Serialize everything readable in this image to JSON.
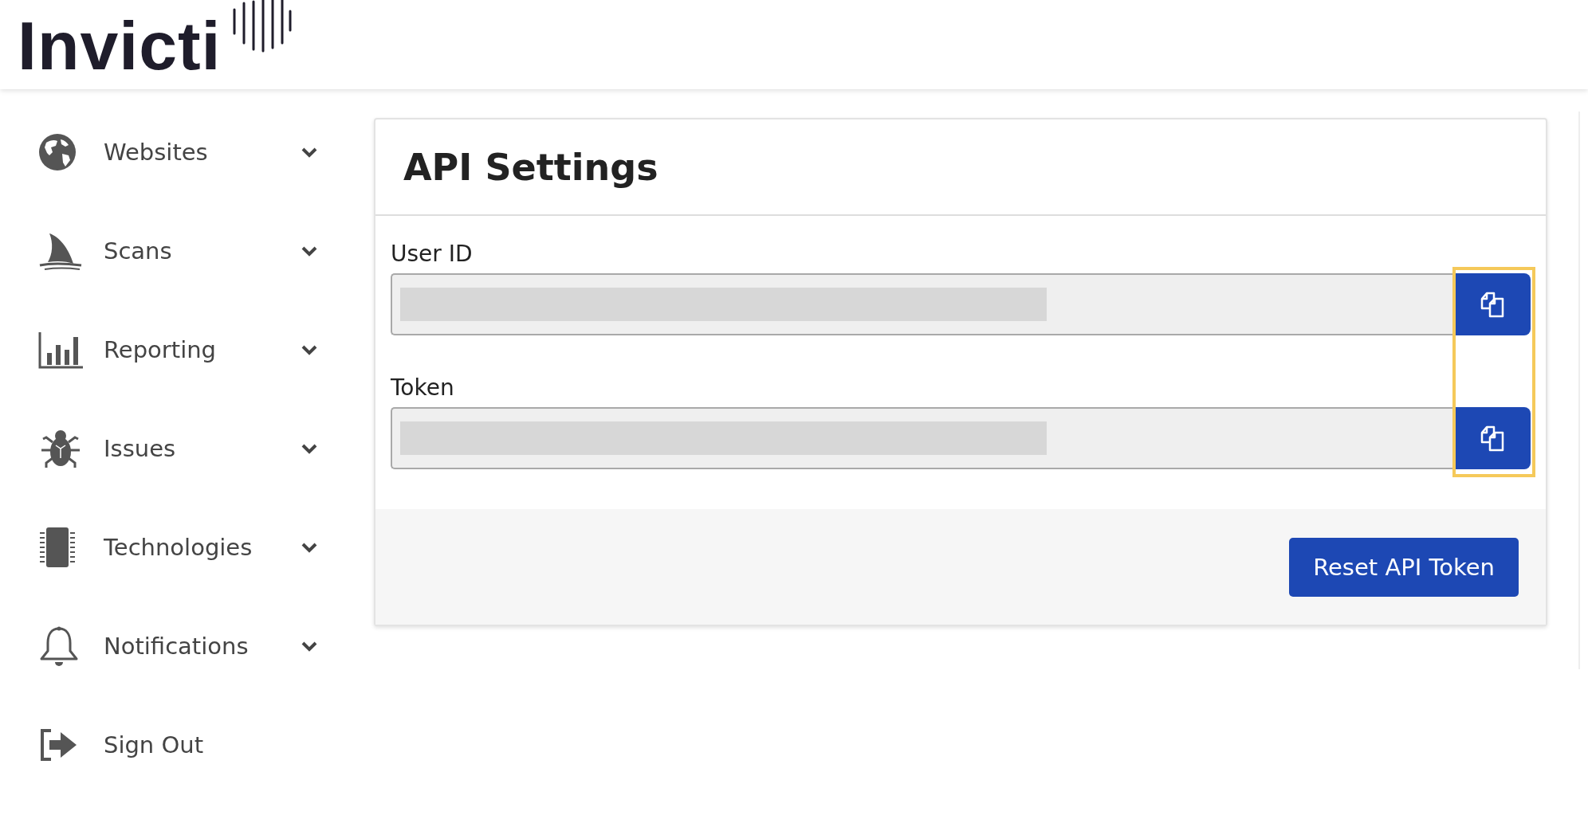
{
  "logo": {
    "text": "Invicti"
  },
  "sidebar": {
    "items": [
      {
        "label": "Websites",
        "kind": "globe",
        "expandable": true
      },
      {
        "label": "Scans",
        "kind": "fin",
        "expandable": true
      },
      {
        "label": "Reporting",
        "kind": "chart",
        "expandable": true
      },
      {
        "label": "Issues",
        "kind": "bug",
        "expandable": true
      },
      {
        "label": "Technologies",
        "kind": "chip",
        "expandable": true
      },
      {
        "label": "Notifications",
        "kind": "bell",
        "expandable": true
      },
      {
        "label": "Sign Out",
        "kind": "signout",
        "expandable": false
      }
    ]
  },
  "card": {
    "title": "API Settings",
    "fields": [
      {
        "label": "User ID",
        "redacted": true
      },
      {
        "label": "Token",
        "redacted": true
      }
    ],
    "reset_button": "Reset API Token"
  }
}
